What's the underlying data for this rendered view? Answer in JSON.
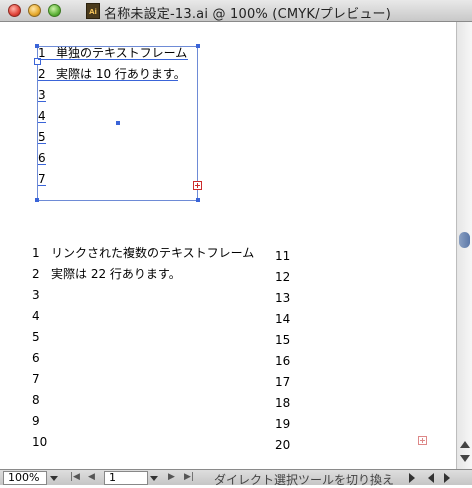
{
  "window": {
    "title": "名称未設定-13.ai @ 100% (CMYK/プレビュー)",
    "doc_icon": "Ai"
  },
  "frame1": {
    "line_numbers": [
      "1",
      "2",
      "3",
      "4",
      "5",
      "6",
      "7"
    ],
    "lines": [
      "単独のテキストフレーム",
      "実際は 10 行あります。"
    ]
  },
  "frame2": {
    "col1_numbers": [
      "1",
      "2",
      "3",
      "4",
      "5",
      "6",
      "7",
      "8",
      "9",
      "10"
    ],
    "col2_numbers": [
      "11",
      "12",
      "13",
      "14",
      "15",
      "16",
      "17",
      "18",
      "19",
      "20"
    ],
    "lines": [
      "リンクされた複数のテキストフレーム",
      "実際は 22 行あります。"
    ]
  },
  "statusbar": {
    "zoom": "100%",
    "page": "1",
    "tool_status": "ダイレクト選択ツールを切り換え"
  },
  "icons": {
    "overflow": "text-overflow-plus-icon",
    "in_port": "text-in-port-icon"
  },
  "colors": {
    "selection": "#3a64d8",
    "overflow": "#cc2b2b"
  }
}
